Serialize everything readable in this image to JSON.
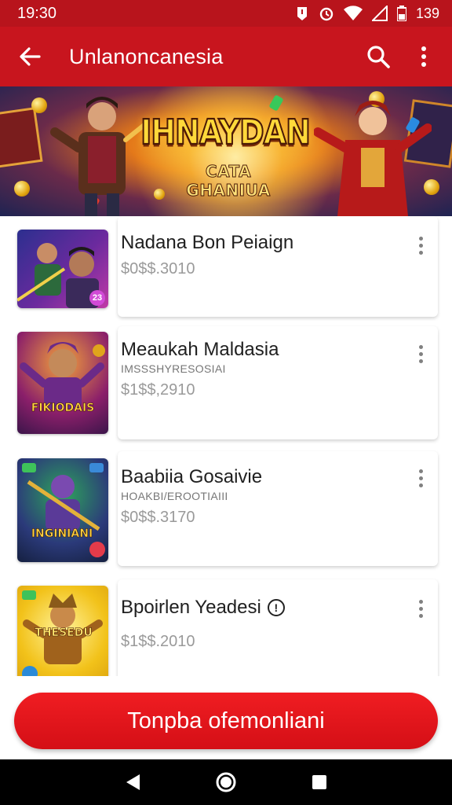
{
  "status_bar": {
    "time": "19:30",
    "battery": "139",
    "icons": [
      "notification-icon",
      "alarm-icon",
      "wifi-icon",
      "signal-icon",
      "battery-icon"
    ]
  },
  "app_bar": {
    "title": "Unlanoncanesia",
    "icons": [
      "back-arrow-icon",
      "search-icon",
      "more-vert-icon"
    ]
  },
  "banner": {
    "title": "IHNAYDAN",
    "subtitle": "CATA GHANIUA"
  },
  "items": [
    {
      "title": "Nadana Bon Peiaign",
      "subtitle": "",
      "price": "$0$$.3010",
      "has_info_badge": false,
      "thumb_badge": "23"
    },
    {
      "title": "Meaukah Maldasia",
      "subtitle": "IMSSSHYRESOSIAI",
      "price": "$1$$,2910",
      "has_info_badge": false,
      "thumb_text": "FIKIODAIS"
    },
    {
      "title": "Baabiia Gosaivie",
      "subtitle": "HOAKBI/EROOTIAIII",
      "price": "$0$$.3170",
      "has_info_badge": false,
      "thumb_text": "INGINIANI"
    },
    {
      "title": "Bpoirlen Yeadesi",
      "subtitle": "",
      "price": "$1$$.2010",
      "has_info_badge": true,
      "thumb_text": "THESEDU"
    }
  ],
  "info_badge_symbol": "!",
  "cta": {
    "label": "Tonpba ofemonliani"
  },
  "colors": {
    "app_bar": "#c8151e",
    "status_bar": "#b8141c",
    "cta": "#e8151c",
    "nav_bar": "#000000"
  },
  "nav_bar": {
    "icons": [
      "back-triangle-icon",
      "home-circle-icon",
      "recents-square-icon"
    ]
  }
}
